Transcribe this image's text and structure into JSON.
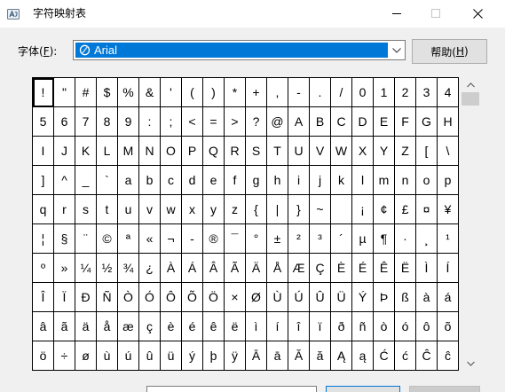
{
  "window": {
    "title": "字符映射表",
    "app_icon": "character-map-app-icon",
    "controls": [
      "minimize-icon",
      "maximize-icon",
      "close-icon"
    ],
    "maximize_enabled": false
  },
  "font_selector": {
    "label_before": "字体(",
    "label_accel": "F",
    "label_after": "):",
    "selected_font": "Arial",
    "font_type_icon": "opentype-font-icon",
    "dropdown_icon": "chevron-down-icon"
  },
  "help_button": {
    "label_before": "帮助(",
    "label_accel": "H",
    "label_after": ")"
  },
  "character_grid": {
    "selected": {
      "row": 0,
      "col": 0
    },
    "rows": [
      [
        "!",
        "\"",
        "#",
        "$",
        "%",
        "&",
        "'",
        "(",
        ")",
        "*",
        "+",
        ",",
        "-",
        ".",
        "/",
        "0",
        "1",
        "2",
        "3",
        "4"
      ],
      [
        "5",
        "6",
        "7",
        "8",
        "9",
        ":",
        ";",
        "<",
        "=",
        ">",
        "?",
        "@",
        "A",
        "B",
        "C",
        "D",
        "E",
        "F",
        "G",
        "H"
      ],
      [
        "I",
        "J",
        "K",
        "L",
        "M",
        "N",
        "O",
        "P",
        "Q",
        "R",
        "S",
        "T",
        "U",
        "V",
        "W",
        "X",
        "Y",
        "Z",
        "[",
        "\\"
      ],
      [
        "]",
        "^",
        "_",
        "`",
        "a",
        "b",
        "c",
        "d",
        "e",
        "f",
        "g",
        "h",
        "i",
        "j",
        "k",
        "l",
        "m",
        "n",
        "o",
        "p"
      ],
      [
        "q",
        "r",
        "s",
        "t",
        "u",
        "v",
        "w",
        "x",
        "y",
        "z",
        "{",
        "|",
        "}",
        "~",
        " ",
        "¡",
        "¢",
        "£",
        "¤",
        "¥"
      ],
      [
        "¦",
        "§",
        "¨",
        "©",
        "ª",
        "«",
        "¬",
        "-",
        "®",
        "¯",
        "°",
        "±",
        "²",
        "³",
        "´",
        "µ",
        "¶",
        "·",
        "¸",
        "¹"
      ],
      [
        "º",
        "»",
        "¼",
        "½",
        "¾",
        "¿",
        "À",
        "Á",
        "Â",
        "Ã",
        "Ä",
        "Å",
        "Æ",
        "Ç",
        "È",
        "É",
        "Ê",
        "Ë",
        "Ì",
        "Í"
      ],
      [
        "Î",
        "Ï",
        "Ð",
        "Ñ",
        "Ò",
        "Ó",
        "Ô",
        "Õ",
        "Ö",
        "×",
        "Ø",
        "Ù",
        "Ú",
        "Û",
        "Ü",
        "Ý",
        "Þ",
        "ß",
        "à",
        "á"
      ],
      [
        "â",
        "ã",
        "ä",
        "å",
        "æ",
        "ç",
        "è",
        "é",
        "ê",
        "ë",
        "ì",
        "í",
        "î",
        "ï",
        "ð",
        "ñ",
        "ò",
        "ó",
        "ô",
        "õ"
      ],
      [
        "ö",
        "÷",
        "ø",
        "ù",
        "ú",
        "û",
        "ü",
        "ý",
        "þ",
        "ÿ",
        "Ā",
        "ā",
        "Ă",
        "ă",
        "Ą",
        "ą",
        "Ć",
        "ć",
        "Ĉ",
        "ĉ"
      ]
    ]
  },
  "scrollbar": {
    "position": 0,
    "up_icon": "chevron-up-icon",
    "down_icon": "chevron-down-icon"
  },
  "colors": {
    "accent": "#0078d7",
    "grid_line": "#000000",
    "dialog_bg": "#f0f0f0",
    "titlebar_bg": "#ffffff",
    "button_bg": "#e1e1e1"
  }
}
